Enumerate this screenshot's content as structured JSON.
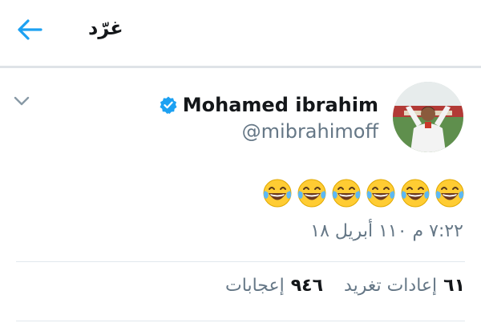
{
  "header": {
    "title": "غرّد",
    "back_icon": "back-arrow-icon"
  },
  "colors": {
    "accent": "#1da1f2",
    "secondary_text": "#657786",
    "primary_text": "#14171a",
    "divider": "#e1e8ed"
  },
  "tweet": {
    "display_name": "Mohamed ibrahim",
    "handle": "@mibrahimoff",
    "verified_icon": "verified-badge-icon",
    "menu_icon": "chevron-down-icon",
    "emoji_icon": "face-with-tears-of-joy-icon",
    "emoji_count": 6,
    "timestamp": "٧:٢٢ م ١١٠ أبريل ١٨"
  },
  "stats": {
    "retweets_count": "٦١",
    "retweets_label": "إعادات تغريد",
    "likes_count": "٩٤٦",
    "likes_label": "إعجابات"
  }
}
